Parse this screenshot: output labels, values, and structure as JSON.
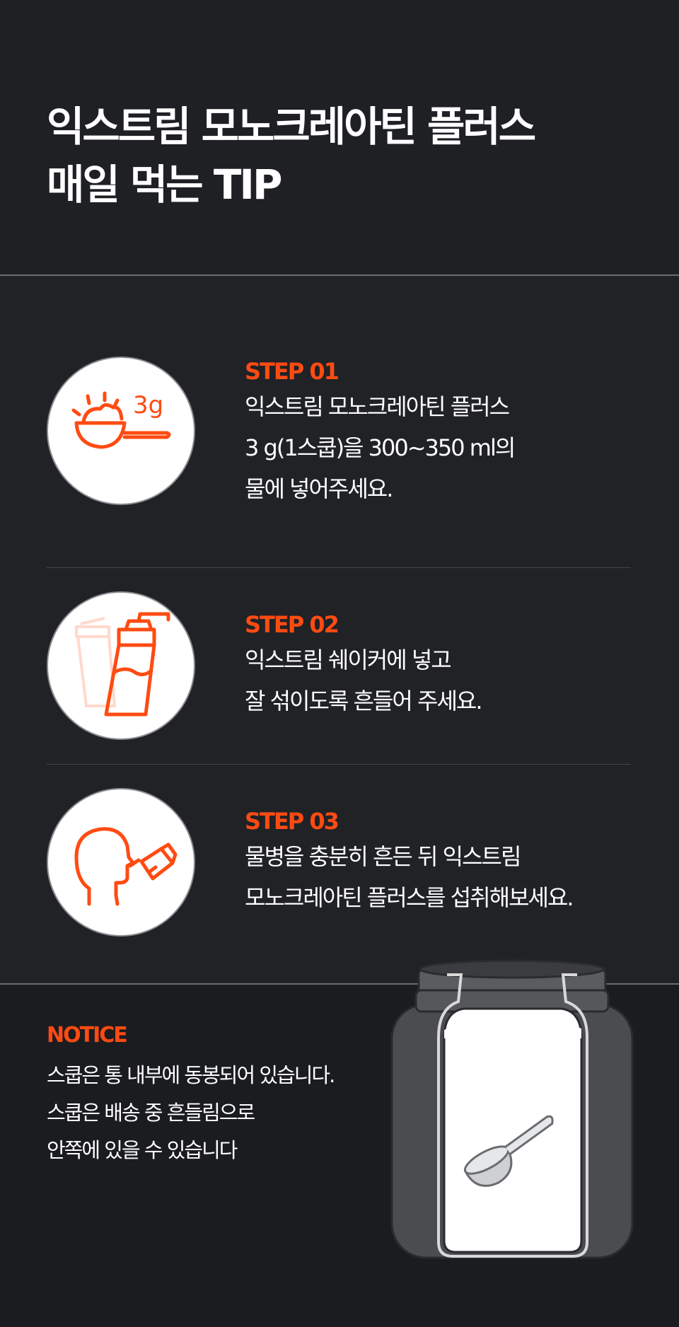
{
  "header": {
    "title_line1": "익스트림 모노크레아틴 플러스",
    "title_line2": "매일 먹는 TIP"
  },
  "steps": [
    {
      "label": "STEP 01",
      "icon": "scoop-icon",
      "icon_text": "3g",
      "lines": [
        "익스트림 모노크레아틴 플러스",
        "3 g(1스쿱)을 300~350 ml의",
        "물에 넣어주세요."
      ]
    },
    {
      "label": "STEP 02",
      "icon": "shaker-icon",
      "lines": [
        "익스트림 쉐이커에 넣고",
        "잘 섞이도록 흔들어 주세요."
      ]
    },
    {
      "label": "STEP 03",
      "icon": "drinking-person-icon",
      "lines": [
        "물병을 충분히 흔든 뒤 익스트림",
        "모노크레아틴 플러스를 섭취해보세요."
      ]
    }
  ],
  "notice": {
    "label": "NOTICE",
    "lines": [
      "스쿱은 통 내부에 동봉되어 있습니다.",
      "스쿱은 배송 중 흔들림으로",
      "안쪽에 있을 수 있습니다"
    ],
    "image": "jar-with-scoop-icon"
  },
  "colors": {
    "accent": "#ff4b12",
    "background": "#1e2024",
    "text": "#ffffff"
  }
}
